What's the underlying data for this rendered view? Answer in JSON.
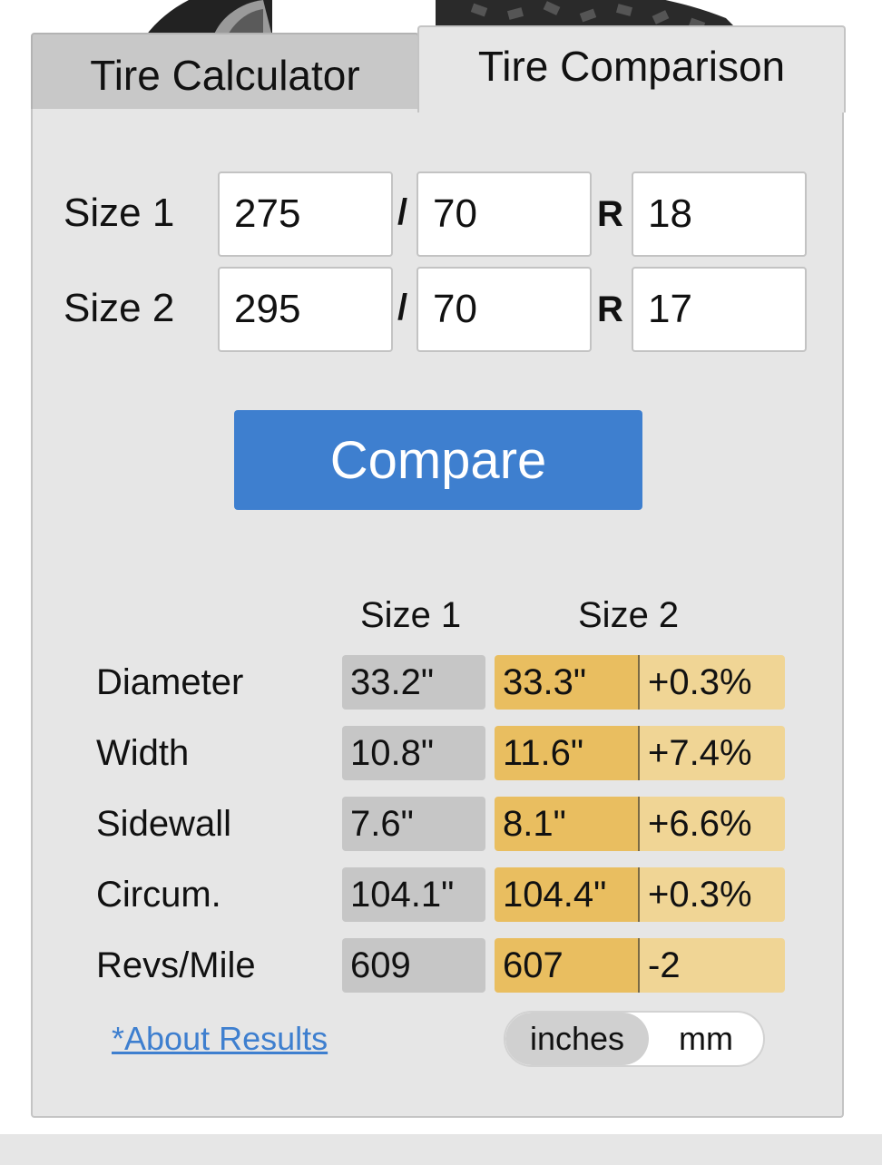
{
  "tabs": {
    "calculator_label": "Tire Calculator",
    "comparison_label": "Tire Comparison"
  },
  "form": {
    "size1": {
      "label": "Size 1",
      "width": "275",
      "aspect": "70",
      "rim": "18"
    },
    "size2": {
      "label": "Size 2",
      "width": "295",
      "aspect": "70",
      "rim": "17"
    },
    "slash": "/",
    "construction": "R",
    "compare_label": "Compare"
  },
  "results": {
    "headers": [
      "Size 1",
      "Size 2"
    ],
    "rows": [
      {
        "label": "Diameter",
        "size1": "33.2\"",
        "size2": "33.3\"",
        "diff": "+0.3%"
      },
      {
        "label": "Width",
        "size1": "10.8\"",
        "size2": "11.6\"",
        "diff": "+7.4%"
      },
      {
        "label": "Sidewall",
        "size1": "7.6\"",
        "size2": "8.1\"",
        "diff": "+6.6%"
      },
      {
        "label": "Circum.",
        "size1": "104.1\"",
        "size2": "104.4\"",
        "diff": "+0.3%"
      },
      {
        "label": "Revs/Mile",
        "size1": "609",
        "size2": "607",
        "diff": "-2"
      }
    ],
    "about_link": "*About Results",
    "units": {
      "options": [
        "inches",
        "mm"
      ],
      "selected": "inches"
    }
  },
  "colors": {
    "accent": "#3e7fcf",
    "size1_cell": "#c6c6c6",
    "size2_cell": "#e9be60",
    "diff_cell": "#f0d595",
    "panel": "#e6e6e6"
  },
  "icons": {
    "header_art": "tire-image"
  }
}
